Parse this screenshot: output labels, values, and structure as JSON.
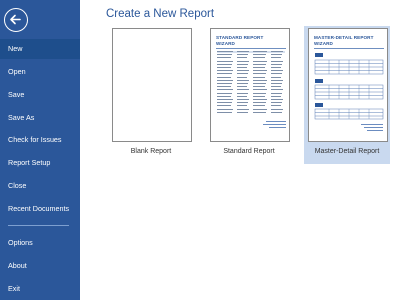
{
  "sidebar": {
    "items": [
      {
        "label": "New",
        "active": true
      },
      {
        "label": "Open"
      },
      {
        "label": "Save"
      },
      {
        "label": "Save As"
      },
      {
        "label": "Check for Issues"
      },
      {
        "label": "Report Setup"
      },
      {
        "label": "Close"
      },
      {
        "label": "Recent Documents"
      }
    ],
    "bottom_items": [
      {
        "label": "Options"
      },
      {
        "label": "About"
      },
      {
        "label": "Exit"
      }
    ]
  },
  "main": {
    "title": "Create a New Report",
    "templates": [
      {
        "label": "Blank Report",
        "selected": false
      },
      {
        "label": "Standard Report",
        "thumb_title": "STANDARD REPORT WIZARD",
        "selected": false
      },
      {
        "label": "Master-Detail Report",
        "thumb_title": "MASTER-DETAIL REPORT WIZARD",
        "selected": true
      }
    ]
  },
  "colors": {
    "sidebar_bg": "#2b579a",
    "active_item_bg": "#1e4e8c",
    "selected_card_bg": "#c9d9ef",
    "accent": "#2b579a"
  }
}
